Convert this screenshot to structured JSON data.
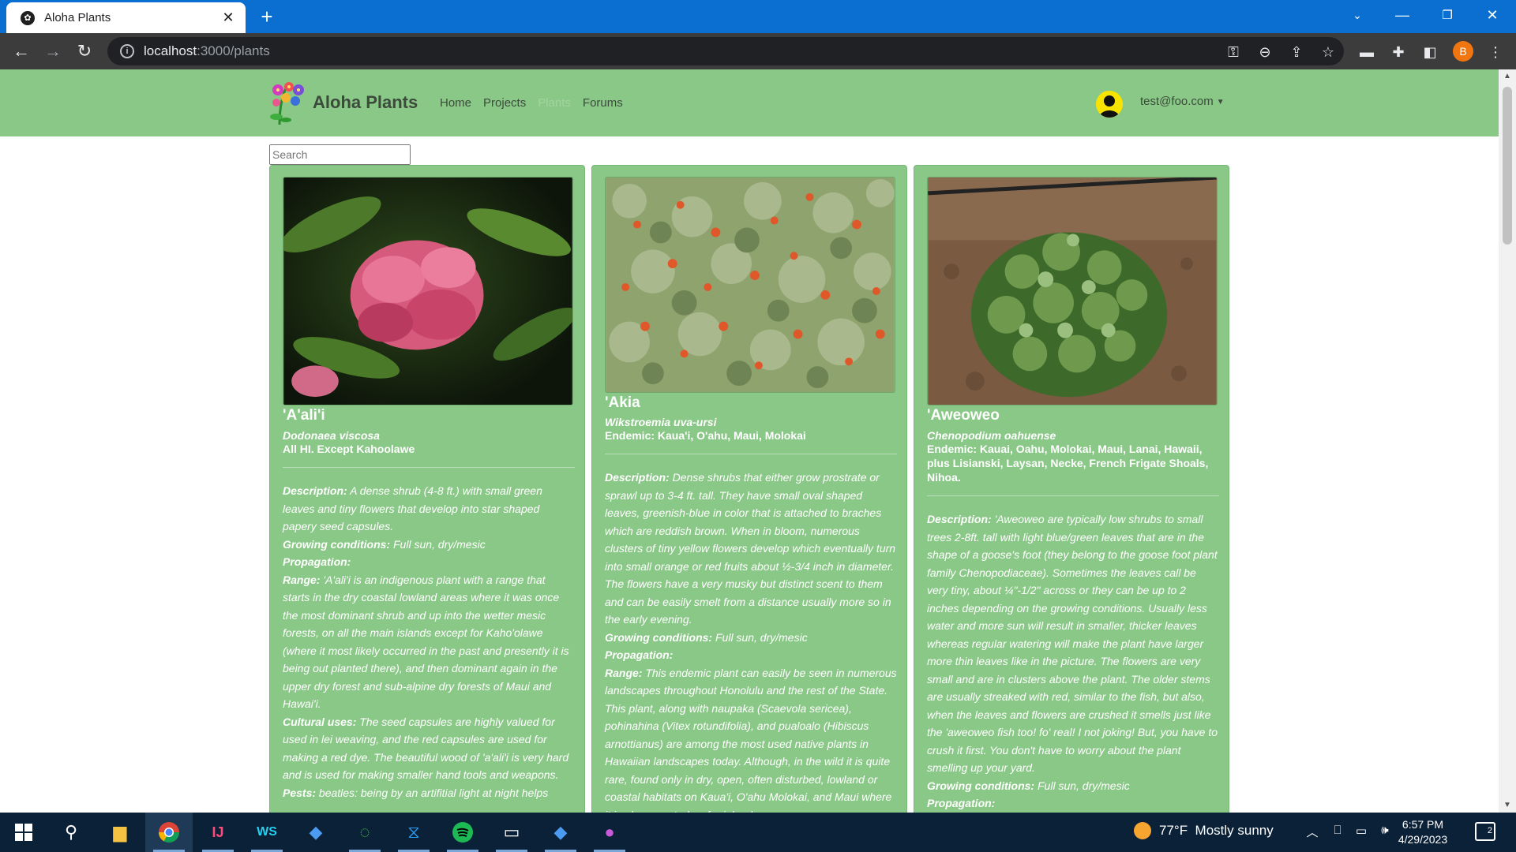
{
  "browser": {
    "tab_title": "Aloha Plants",
    "url_host": "localhost",
    "url_path": ":3000/plants",
    "profile_initial": "B"
  },
  "site": {
    "brand": "Aloha Plants",
    "nav": [
      "Home",
      "Projects",
      "Plants",
      "Forums"
    ],
    "active_nav": "Plants",
    "user_email": "test@foo.com",
    "search_placeholder": "Search"
  },
  "plants": [
    {
      "name": "'A'ali'i",
      "scientific": "Dodonaea viscosa",
      "range_line": "All HI. Except Kahoolawe",
      "description": "A dense shrub (4-8 ft.) with small green leaves and tiny flowers that develop into star shaped papery seed capsules.",
      "growing": "Full sun, dry/mesic",
      "propagation": "",
      "range": "'A'ali'i is an indigenous plant with a range that starts in the dry coastal lowland areas where it was once the most dominant shrub and up into the wetter mesic forests, on all the main islands except for Kaho'olawe (where it most likely occurred in the past and presently it is being out planted there), and then dominant again in the upper dry forest and sub-alpine dry forests of Maui and Hawai'i.",
      "cultural": "The seed capsules are highly valued for used in lei weaving, and the red capsules are used for making a red dye. The beautiful wood of 'a'ali'i is very hard and is used for making smaller hand tools and weapons.",
      "pests": "beatles: being by an artifitial light at night helps"
    },
    {
      "name": "'Akia",
      "scientific": "Wikstroemia uva-ursi",
      "range_line": "Endemic: Kaua'i, O'ahu, Maui, Molokai",
      "description": "Dense shrubs that either grow prostrate or sprawl up to 3-4 ft. tall. They have small oval shaped leaves, greenish-blue in color that is attached to braches which are reddish brown. When in bloom, numerous clusters of tiny yellow flowers develop which eventually turn into small orange or red fruits about ½-3/4 inch in diameter. The flowers have a very musky but distinct scent to them and can be easily smelt from a distance usually more so in the early evening.",
      "growing": "Full sun, dry/mesic",
      "propagation": "",
      "range": "This endemic plant can easily be seen in numerous landscapes throughout Honolulu and the rest of the State. This plant, along with naupaka (Scaevola sericea), pohinahina (Vitex rotundifolia), and pualoalo (Hibiscus arnottianus) are among the most used native plants in Hawaiian landscapes today. Although, in the wild it is quite rare, found only in dry, open, often disturbed, lowland or coastal habitats on Kaua'i, O'ahu Molokai, and Maui where it is also reported as far inland"
    },
    {
      "name": "'Aweoweo",
      "scientific": "Chenopodium oahuense",
      "range_line": "Endemic: Kauai, Oahu, Molokai, Maui, Lanai, Hawaii, plus Lisianski, Laysan, Necke, French Frigate Shoals, Nihoa.",
      "description": "'Aweoweo are typically low shrubs to small trees 2-8ft. tall with light blue/green leaves that are in the shape of a goose's foot (they belong to the goose foot plant family Chenopodiaceae). Sometimes the leaves call be very tiny, about ¼\"-1/2\" across or they can be up to 2 inches depending on the growing conditions. Usually less water and more sun will result in smaller, thicker leaves whereas regular watering will make the plant have larger more thin leaves like in the picture. The flowers are very small and are in clusters above the plant. The older stems are usually streaked with red, similar to the fish, but also, when the leaves and flowers are crushed it smells just like the 'aweoweo fish too! fo' real! I not joking! But, you have to crush it first. You don't have to worry about the plant smelling up your yard.",
      "growing": "Full sun, dry/mesic",
      "propagation": ""
    }
  ],
  "labels": {
    "description": "Description:",
    "growing": "Growing conditions:",
    "propagation": "Propagation:",
    "range": "Range:",
    "cultural": "Cultural uses:",
    "pests": "Pests:"
  },
  "taskbar": {
    "weather_temp": "77°F",
    "weather_text": "Mostly sunny",
    "time": "6:57 PM",
    "date": "4/29/2023",
    "notification_count": "2"
  },
  "colors": {
    "navbar": "#8ac887",
    "card": "#8ac887",
    "chrome_titlebar": "#0a6fd1",
    "chrome_toolbar": "#3c3c3c",
    "taskbar": "#0b2138"
  }
}
